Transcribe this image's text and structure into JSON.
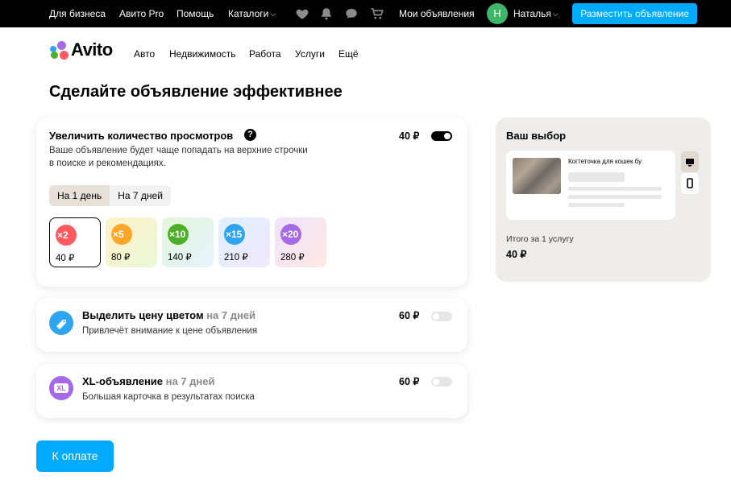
{
  "topbar": {
    "for_business": "Для бизнеса",
    "avito_pro": "Авито Pro",
    "help": "Помощь",
    "catalogs": "Каталоги",
    "my_ads": "Мои объявления",
    "user_initial": "Н",
    "user_name": "Наталья",
    "post_ad": "Разместить объявление",
    "icons": [
      "heart-icon",
      "bell-icon",
      "chat-icon",
      "cart-icon",
      "chevron-down-icon"
    ]
  },
  "header": {
    "logo_text": "Avito",
    "nav": [
      "Авто",
      "Недвижимость",
      "Работа",
      "Услуги",
      "Ещё"
    ]
  },
  "page_title": "Сделайте объявление эффективнее",
  "views_card": {
    "title": "Увеличить количество просмотров",
    "help_glyph": "?",
    "description_line1": "Ваше объявление будет чаще попадать на верхние строчки",
    "description_line2": "в поиске и рекомендациях.",
    "price": "40 ₽",
    "enabled": true,
    "periods": [
      "На 1 день",
      "На 7 дней"
    ],
    "selected_period": "На 1 день",
    "multipliers": [
      {
        "label": "×2",
        "price": "40 ₽",
        "color": "#ff5a5f",
        "selected": true
      },
      {
        "label": "×5",
        "price": "80 ₽",
        "color": "#ffa726",
        "selected": false
      },
      {
        "label": "×10",
        "price": "140 ₽",
        "color": "#4caf27",
        "selected": false
      },
      {
        "label": "×15",
        "price": "210 ₽",
        "color": "#2fa4f0",
        "selected": false
      },
      {
        "label": "×20",
        "price": "280 ₽",
        "color": "#a66ae6",
        "selected": false
      }
    ]
  },
  "highlight_card": {
    "title": "Выделить цену цветом",
    "period": "на 7 дней",
    "description": "Привлечёт внимание к цене объявления",
    "price": "60 ₽",
    "enabled": false,
    "icon": "tag-icon",
    "icon_color": "#2fa4f0"
  },
  "xl_card": {
    "title": "XL-объявление",
    "period": "на 7 дней",
    "description": "Большая карточка в результатах поиска",
    "price": "60 ₽",
    "enabled": false,
    "icon_text": "XL",
    "icon_color": "#a66ae6"
  },
  "summary": {
    "title": "Ваш выбор",
    "ad_title": "Когтеточка для кошек бу",
    "total_label": "Итого за 1 услугу",
    "total_price": "40 ₽",
    "devices": [
      "desktop-icon",
      "mobile-icon"
    ]
  },
  "pay_button": "К оплате",
  "colors": {
    "accent": "#00aaff",
    "topbar_bg": "#000000",
    "panel_bg": "#efede9",
    "segment_active": "#e6e0d8"
  }
}
